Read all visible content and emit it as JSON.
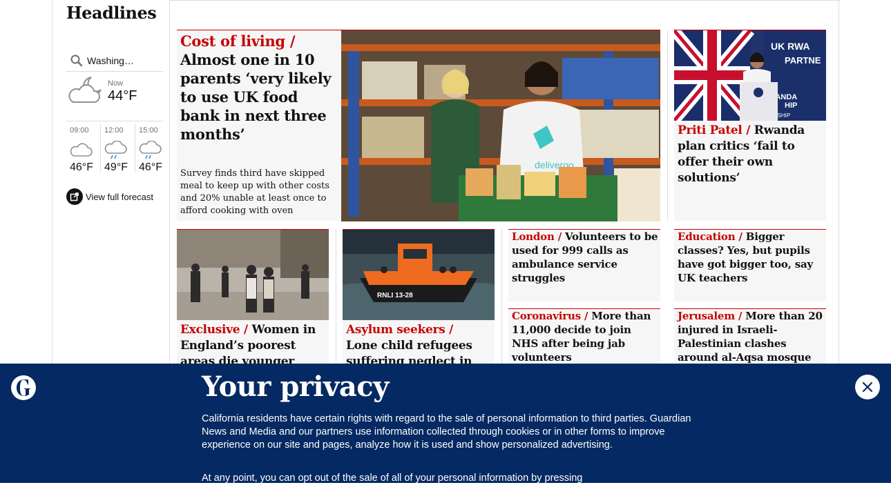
{
  "section": {
    "title": "Headlines"
  },
  "weather": {
    "location": "Washing…",
    "now_label": "Now",
    "now_temp": "44°F",
    "forecast": [
      {
        "time": "09:00",
        "temp": "46°F",
        "icon": "cloud-icon"
      },
      {
        "time": "12:00",
        "temp": "49°F",
        "icon": "rain-cloud-icon"
      },
      {
        "time": "15:00",
        "temp": "46°F",
        "icon": "rain-cloud-icon"
      }
    ],
    "full_forecast_label": "View full forecast"
  },
  "main_story": {
    "kicker": "Cost of living",
    "slash": "/",
    "headline": "Almost one in 10 parents ‘very likely to use UK food bank in next three months’",
    "standfirst": "Survey finds third have skipped meal to keep up with other costs and 20% unable at least once to afford cooking with oven",
    "image_alt": "Volunteers packing food at a food bank"
  },
  "side_story": {
    "kicker": "Priti Patel",
    "headline": "Rwanda plan critics ‘fail to offer their own solutions’",
    "image_text_1": "UK RWA",
    "image_text_2": "PARTNE",
    "image_text_3": "UK RWANDA",
    "image_text_4": "HIP",
    "image_text_5": "PARTNERSHIP"
  },
  "stories": [
    {
      "kicker": "Exclusive",
      "headline": "Women in England’s poorest areas die younger than"
    },
    {
      "kicker": "Asylum seekers",
      "headline": "Lone child refugees suffering neglect in UK"
    },
    {
      "kicker": "London",
      "headline": "Volunteers to be used for 999 calls as ambulance service struggles"
    },
    {
      "kicker": "Education",
      "headline": "Bigger classes? Yes, but pupils have got bigger too, say UK teachers"
    },
    {
      "kicker": "Coronavirus",
      "headline": "More than 11,000 decide to join NHS after being jab volunteers"
    },
    {
      "kicker": "Jerusalem",
      "headline": "More than 20 injured in Israeli-Palestinian clashes around al-Aqsa mosque"
    }
  ],
  "lifeboat_label": "RNLI 13-28",
  "privacy": {
    "title": "Your privacy",
    "p1": "California residents have certain rights with regard to the sale of personal information to third parties. Guardian News and Media and our partners use information collected through cookies or in other forms to improve experience on our site and pages, analyze how it is used and show personalized advertising.",
    "p2": "At any point, you can opt out of the sale of all of your personal information by pressing"
  },
  "colors": {
    "accent": "#c70000",
    "banner": "#052962",
    "card_bg": "#f6f6f6"
  }
}
